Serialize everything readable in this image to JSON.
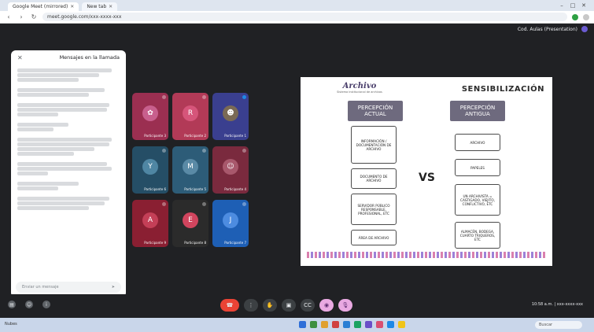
{
  "browser": {
    "tabs": [
      {
        "label": "Google Meet (mirrored)",
        "active": true
      },
      {
        "label": "New tab",
        "active": false
      }
    ],
    "address": "meet.google.com/xxx-xxxx-xxx"
  },
  "meet": {
    "top_label": "Cod. Aulas (Presentation)",
    "chat": {
      "title": "Mensajes en la llamada",
      "input_placeholder": "Enviar un mensaje"
    },
    "participants": [
      {
        "name": "Participante 1",
        "initial": "",
        "color": "#3a3f8f"
      },
      {
        "name": "Participante 2",
        "initial": "R",
        "color": "#b23a57"
      },
      {
        "name": "Participante 3",
        "initial": "",
        "color": "#b23a57"
      },
      {
        "name": "Participante 4",
        "initial": "",
        "color": "#8a2f45"
      },
      {
        "name": "Participante 5",
        "initial": "M",
        "color": "#2d5c78"
      },
      {
        "name": "Participante 6",
        "initial": "",
        "color": "#2d5c78"
      },
      {
        "name": "Participante 7",
        "initial": "J",
        "color": "#1e5fb5"
      },
      {
        "name": "Participante 8",
        "initial": "",
        "color": "#3a2d2d"
      },
      {
        "name": "Participante 9",
        "initial": "A",
        "color": "#8a1f32"
      }
    ],
    "slide": {
      "title": "SENSIBILIZACIÓN",
      "logo": "Archivo",
      "logo_sub": "Sistema institucional de archivos",
      "left_head": "PERCEPCIÓN ANTIGUA",
      "right_head": "PERCEPCIÓN ACTUAL",
      "left_items": [
        "ARCHIVO",
        "PAPELES",
        "UN ARCHIVISTA = CASTIGADO, VIEJITO, CONFLICTIVO, ETC",
        "ALMACÉN, BODEGA, CUARTO TRIQUEROS, ETC"
      ],
      "right_items": [
        "INFORMACIÓN / DOCUMENTACIÓN DE ARCHIVO",
        "DOCUMENTO DE ARCHIVO",
        "SERVIDOR PÚBLICO RESPONSABLE, PROFESIONAL, ETC",
        "ÁREA DE ARCHIVO"
      ],
      "vs": "VS"
    },
    "controls_time": "10:58 a.m. | xxx-xxxx-xxx"
  },
  "taskbar": {
    "left": "Nubes",
    "search": "Buscar"
  }
}
